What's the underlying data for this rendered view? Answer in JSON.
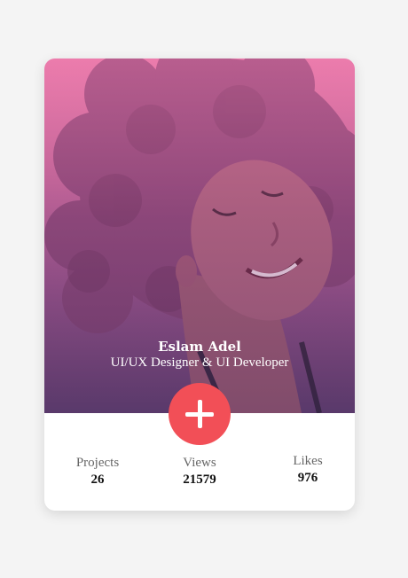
{
  "profile": {
    "name": "Eslam Adel",
    "role": "UI/UX Designer & UI Developer"
  },
  "stats": [
    {
      "label": "Projects",
      "value": "26"
    },
    {
      "label": "Views",
      "value": "21579"
    },
    {
      "label": "Likes",
      "value": "976"
    }
  ],
  "colors": {
    "accent": "#f24f57",
    "card_bg": "#ffffff",
    "page_bg": "#f4f4f4"
  },
  "icons": {
    "add_button": "plus-icon"
  }
}
